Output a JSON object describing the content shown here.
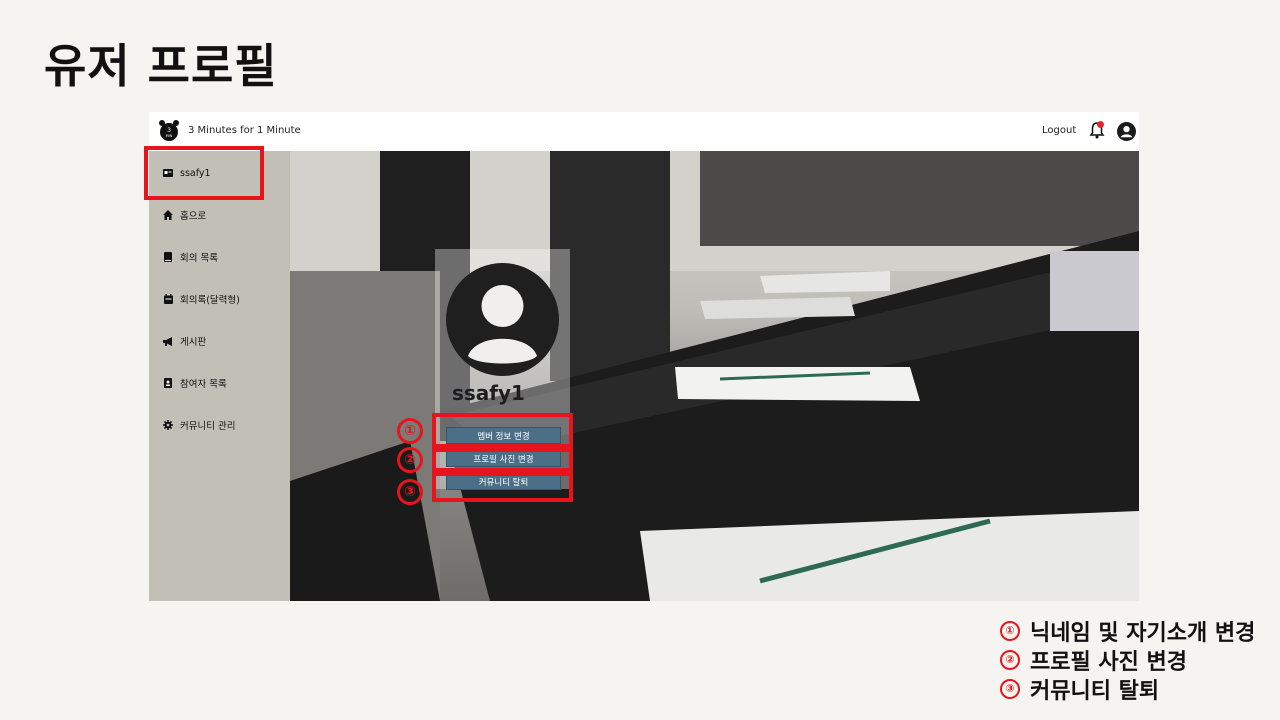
{
  "slide": {
    "title": "유저 프로필"
  },
  "header": {
    "app_name": "3 Minutes for 1 Minute",
    "logout": "Logout",
    "notification_count": "1"
  },
  "sidebar": {
    "items": [
      {
        "label": "ssafy1",
        "icon": "id-card-icon"
      },
      {
        "label": "홈으로",
        "icon": "home-icon"
      },
      {
        "label": "회의 목록",
        "icon": "book-icon"
      },
      {
        "label": "회의록(달력형)",
        "icon": "calendar-icon"
      },
      {
        "label": "게시판",
        "icon": "megaphone-icon"
      },
      {
        "label": "참여자 목록",
        "icon": "contact-book-icon"
      },
      {
        "label": "커뮤니티 관리",
        "icon": "gear-icon"
      }
    ]
  },
  "profile": {
    "username": "ssafy1",
    "buttons": [
      {
        "label": "멤버 정보 변경"
      },
      {
        "label": "프로필 사진 변경"
      },
      {
        "label": "커뮤니티 탈퇴"
      }
    ]
  },
  "annotations": {
    "markers": [
      "①",
      "②",
      "③"
    ],
    "legend": [
      {
        "num": "①",
        "text": "닉네임 및 자기소개 변경"
      },
      {
        "num": "②",
        "text": "프로필 사진 변경"
      },
      {
        "num": "③",
        "text": "커뮤니티 탈퇴"
      }
    ]
  },
  "colors": {
    "highlight": "#e8141c",
    "button": "#4b6f86",
    "sidebar": "#c2c0b6"
  }
}
